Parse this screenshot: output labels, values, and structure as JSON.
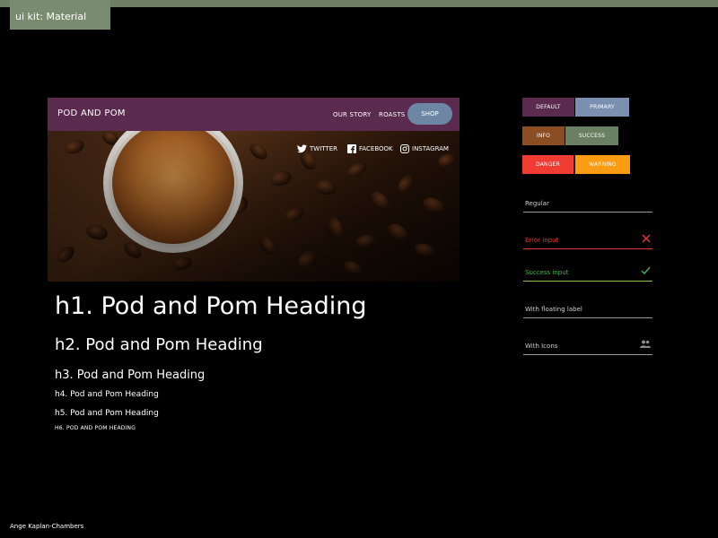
{
  "kit_tag": "ui kit: Material",
  "hero": {
    "brand": "POD AND POM",
    "nav": [
      "OUR STORY",
      "ROASTS"
    ],
    "shop_label": "SHOP",
    "social": [
      "TWITTER",
      "FACEBOOK",
      "INSTAGRAM"
    ]
  },
  "headings": {
    "h1": "h1. Pod and Pom Heading",
    "h2": "h2. Pod and Pom Heading",
    "h3": "h3. Pod and Pom Heading",
    "h4": "h4. Pod and Pom Heading",
    "h5": "h5. Pod and Pom Heading",
    "h6": "H6. POD AND POM HEADING"
  },
  "buttons": {
    "default": "DEFAULT",
    "primary": "PRIMARY",
    "info": "INFO",
    "success": "SUCCESS",
    "danger": "DANGER",
    "warning": "WARNING"
  },
  "colors": {
    "default": "#5b2a4f",
    "primary": "#7b8fb0",
    "info": "#8a4e22",
    "success": "#6b7f62",
    "danger": "#f13c33",
    "warning": "#fb9c12",
    "error_text": "#e53935",
    "success_text": "#4caf50"
  },
  "inputs": {
    "regular": "Regular",
    "error": "Error input",
    "success": "Success input",
    "floating": "With floating label",
    "icons": "With Icons"
  },
  "footer": "Ange Kaplan-Chambers"
}
